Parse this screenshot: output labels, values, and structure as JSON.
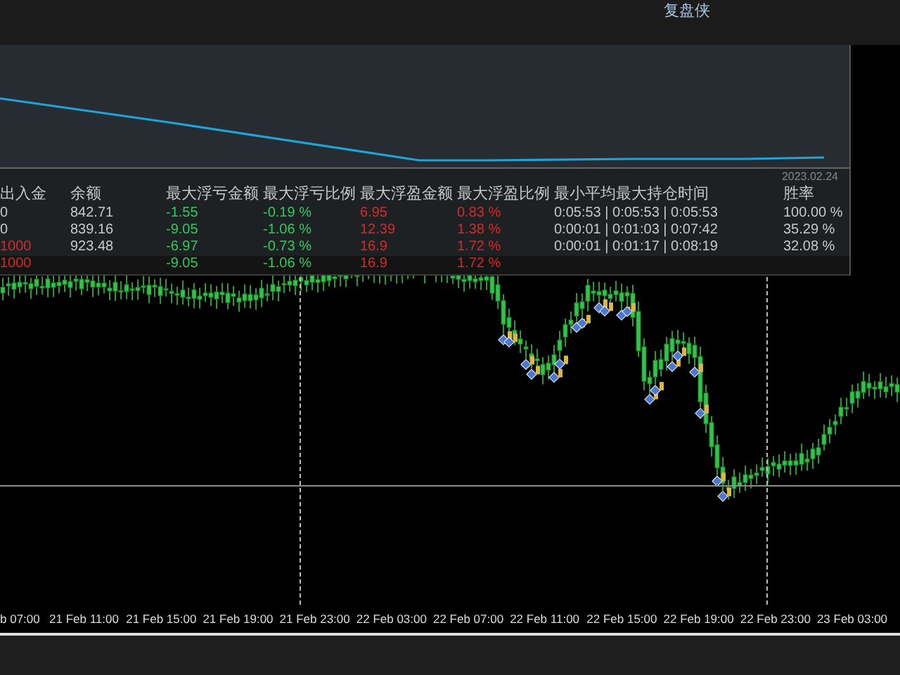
{
  "top_bar": {
    "title": "复盘侠"
  },
  "equity_panel": {
    "date": "2023.02.24"
  },
  "stats_table": {
    "columns": [
      "出入金",
      "余额",
      "最大浮亏金额",
      "最大浮亏比例",
      "最大浮盈金额",
      "最大浮盈比例",
      "最小平均最大持仓时间",
      "胜率"
    ],
    "rows": [
      {
        "kind": "trade",
        "cells": [
          {
            "text": "0",
            "kind": "plain"
          },
          {
            "text": "842.71",
            "kind": "plain"
          },
          {
            "text": "-1.55",
            "kind": "loss"
          },
          {
            "text": "-0.19 %",
            "kind": "loss"
          },
          {
            "text": "6.95",
            "kind": "profit"
          },
          {
            "text": "0.83 %",
            "kind": "profit"
          },
          {
            "text": "0:05:53 | 0:05:53 | 0:05:53",
            "kind": "plain"
          },
          {
            "text": "100.00 %",
            "kind": "plain"
          }
        ]
      },
      {
        "kind": "trade",
        "cells": [
          {
            "text": "0",
            "kind": "plain"
          },
          {
            "text": "839.16",
            "kind": "plain"
          },
          {
            "text": "-9.05",
            "kind": "loss"
          },
          {
            "text": "-1.06 %",
            "kind": "loss"
          },
          {
            "text": "12.39",
            "kind": "profit"
          },
          {
            "text": "1.38 %",
            "kind": "profit"
          },
          {
            "text": "0:00:01 | 0:01:03 | 0:07:42",
            "kind": "plain"
          },
          {
            "text": "35.29 %",
            "kind": "plain"
          }
        ]
      },
      {
        "kind": "trade",
        "cells": [
          {
            "text": "1000",
            "kind": "deposit"
          },
          {
            "text": "923.48",
            "kind": "plain"
          },
          {
            "text": "-6.97",
            "kind": "loss"
          },
          {
            "text": "-0.73 %",
            "kind": "loss"
          },
          {
            "text": "16.9",
            "kind": "profit"
          },
          {
            "text": "1.72 %",
            "kind": "profit"
          },
          {
            "text": "0:00:01 | 0:01:17 | 0:08:19",
            "kind": "plain"
          },
          {
            "text": "32.08 %",
            "kind": "plain"
          }
        ]
      },
      {
        "kind": "total",
        "cells": [
          {
            "text": "1000",
            "kind": "deposit"
          },
          null,
          {
            "text": "-9.05",
            "kind": "loss"
          },
          {
            "text": "-1.06 %",
            "kind": "loss"
          },
          {
            "text": "16.9",
            "kind": "profit"
          },
          {
            "text": "1.72 %",
            "kind": "profit"
          },
          null,
          null
        ]
      }
    ]
  },
  "time_axis": {
    "labels": [
      "b 07:00",
      "21 Feb 11:00",
      "21 Feb 15:00",
      "21 Feb 19:00",
      "21 Feb 23:00",
      "22 Feb 03:00",
      "22 Feb 07:00",
      "22 Feb 11:00",
      "22 Feb 15:00",
      "22 Feb 19:00",
      "22 Feb 23:00",
      "23 Feb 03:00"
    ]
  }
}
